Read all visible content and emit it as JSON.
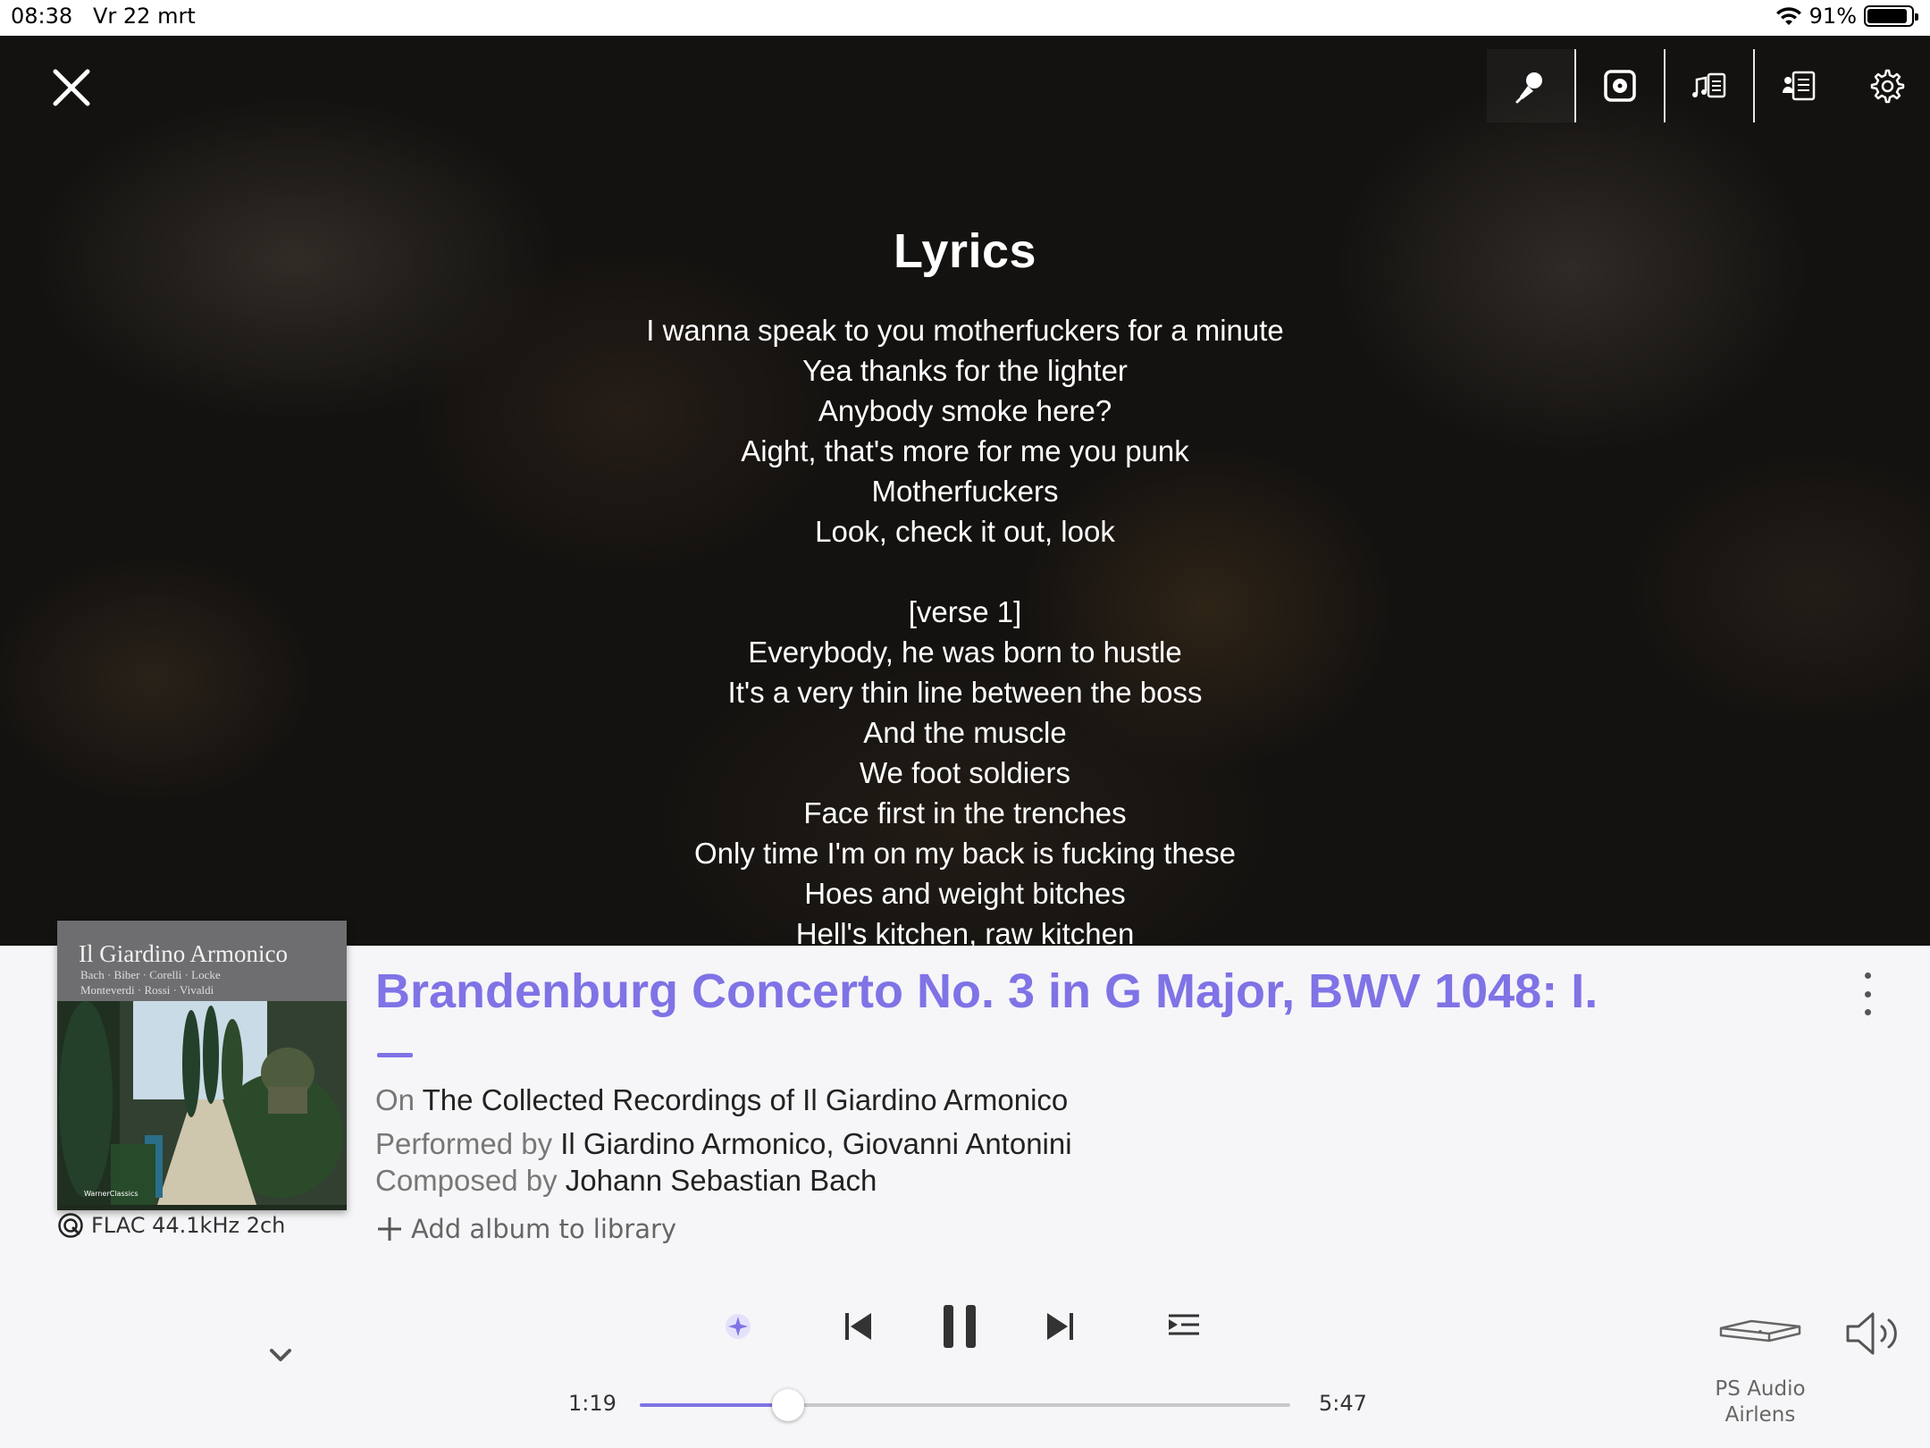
{
  "status_bar": {
    "time": "08:38",
    "date": "Vr 22 mrt",
    "battery": "91%",
    "battery_level": 0.91
  },
  "toolbar": {
    "icons": [
      "microphone-icon",
      "album-view-icon",
      "music-notes-icon",
      "document-icon",
      "settings-icon"
    ]
  },
  "lyrics": {
    "title": "Lyrics",
    "lines": [
      "I wanna speak to you motherfuckers for a minute",
      "Yea thanks for the lighter",
      "Anybody smoke here?",
      "Aight, that's more for me you punk",
      "Motherfuckers",
      "Look, check it out, look",
      "",
      "[verse 1]",
      "Everybody, he was born to hustle",
      "It's a very thin line between the boss",
      "And the muscle",
      "We foot soldiers",
      "Face first in the trenches",
      "Only time I'm on my back is fucking these",
      "Hoes and weight bitches",
      "Hell's kitchen, raw kitchen"
    ]
  },
  "album_art": {
    "title": "Il Giardino Armonico",
    "names_line1": "Bach · Biber · Corelli · Locke",
    "names_line2": "Monteverdi · Rossi · Vivaldi",
    "label": "WarnerClassics"
  },
  "format": "FLAC 44.1kHz 2ch",
  "track": {
    "title": "Brandenburg Concerto No. 3 in G Major, BWV 1048: I.",
    "on_prefix": "On",
    "album": "The Collected Recordings of Il Giardino Armonico",
    "performed_prefix": "Performed by",
    "performers": "Il Giardino Armonico, Giovanni Antonini",
    "composed_prefix": "Composed by",
    "composer": "Johann Sebastian Bach",
    "add_album": "Add album to library"
  },
  "playback": {
    "elapsed": "1:19",
    "total": "5:47",
    "progress": 0.2277
  },
  "zone": {
    "line1": "PS Audio",
    "line2": "Airlens"
  },
  "colors": {
    "accent": "#7f73e6",
    "player_bg": "#f6f6f8",
    "lyrics_bg": "#141210"
  }
}
